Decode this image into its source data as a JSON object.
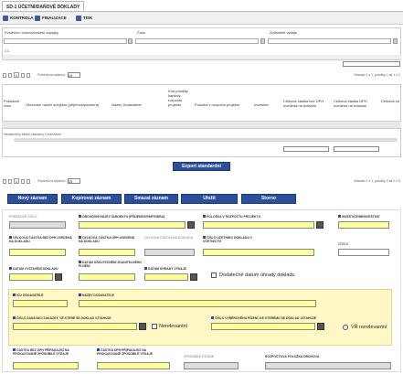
{
  "tab": {
    "title": "SD-1 ÚČETNÍ/DAŇOVÉ DOKLADY"
  },
  "toolbar": {
    "kontrola": "KONTROLA",
    "finalizace": "FINALIZACE",
    "tisk": "TISK"
  },
  "top_grid": {
    "col1": "Evidenční číslo/označení zapojky",
    "col2": "Číslo",
    "col3": "Způsobilé výdaje",
    "row_value": "CC",
    "page": "1",
    "page_size_label": "Položek na stránku:",
    "page_size": "10",
    "pager_info": "Stránka 1 z 1, položky 1 až 1 z 1"
  },
  "mid_grid": {
    "headers": [
      "Pořadové číslo",
      "Obchodní název subjektu (příjemce/partnera)",
      "Název Dodavatele",
      "Kód položky kapitoly rozpočtu projektu",
      "Položka v rozpočtu projektu",
      "Investice",
      "Celková částka bez DPH uvedená na dokladu",
      "Celková částka DPH uvedená na dokladu",
      "Celková čá"
    ],
    "empty": "Nenalezeny žádné záznamy k zobrazení",
    "page": "1",
    "page_size_label": "Položek na stránku:",
    "page_size": "25",
    "pager_info": "Stránka 1 z 1, položky 0 až 0 z 0"
  },
  "export_label": "Export standardní",
  "actions": {
    "new": "Nový záznam",
    "copy": "Kopírovat záznam",
    "delete": "Smazat záznam",
    "save": "Uložit",
    "cancel": "Storno"
  },
  "form": {
    "poradove_cislo": "POŘADOVÉ ČÍSLO",
    "obchodni_nazev": "OBCHODNÍ NÁZEV SUBJEKTU (PŘÍJEMCE/PARTNERA)",
    "polozka_rozpoctu": "POLOŽKA V ROZPOČTU PROJEKTU",
    "investice": "INVESTICE/NEINVESTICE",
    "bez_dph": "CELKOVÁ ČÁSTKA BEZ DPH UVEDENÁ NA DOKLADU",
    "dph": "CELKOVÁ ČÁSTKA DPH UVEDENÁ NA DOKLADU",
    "celkova": "CELKOVÁ ČÁSTKA NA DOKLADU",
    "cislo_dokladu": "ČÍSLO ÚČETNÍHO DOKLADU V ÚČETNICTVÍ",
    "zdroj": "ZDROJ",
    "datum_vystaveni": "DATUM VYSTAVENÍ DOKLADU",
    "datum_zauct": "DATUM USKUTEČNĚNÍ ZDANITELNÉHO PLNĚNÍ",
    "datum_uhrady": "DATUM ÚHRADY VÝDAJE",
    "dodatecne": "Dodatečné datum úhrady dokladu",
    "ico": "IČO DODAVATELE",
    "nazev_dod": "NÁZEV DODAVATELE",
    "cislo_zakazky": "ČÍSLO ZADÁVACÍ ZAKÁZKY, VE KTERÉ SE DOKLAD VZTAHUJE",
    "nerelevantni": "Nerelevantní",
    "cislo_vyb": "ČÍSLO VÝBĚROVÉHO ŘÍZENÍ, KE KTERÉMU SE DOKLAD VZTAHUJE",
    "vr_nerelevantni": "VŘ nerelevantní",
    "castka_bez": "ČÁSTKA BEZ DPH PŘIPADAJÍCÍ NA PROKAZOVANÉ ZPŮSOBILÉ VÝDAJE",
    "castka_dph": "ČÁSTKA DPH PŘIPADAJÍCÍ NA PROKAZOVANÉ ZPŮSOBILÉ VÝDAJE",
    "zpusobile": "ZPŮSOBILÉ VÝDAJE",
    "rozpoctova": "ROZPOČTOVÁ POLOŽKA DRUHOVÁ"
  }
}
